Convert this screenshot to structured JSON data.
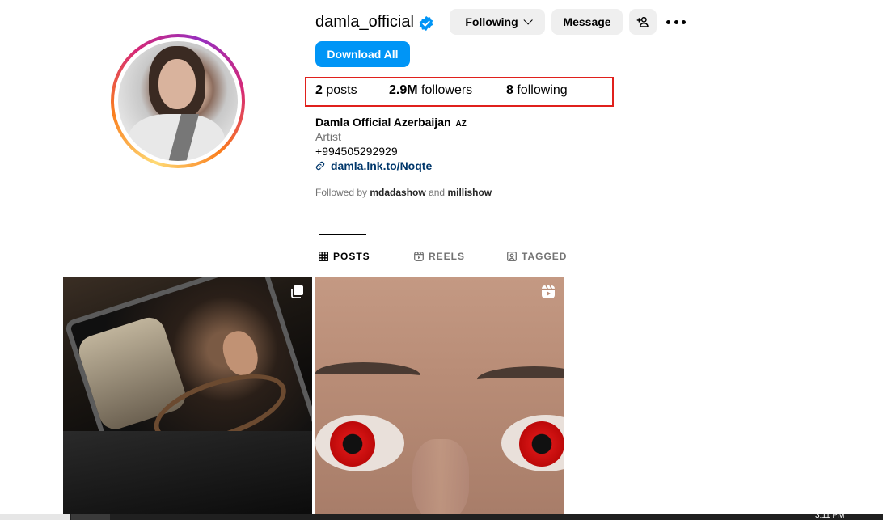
{
  "profile": {
    "username": "damla_official",
    "verified": true,
    "buttons": {
      "following": "Following",
      "message": "Message",
      "download_all": "Download All"
    },
    "stats": {
      "posts_count": "2",
      "posts_label": "posts",
      "followers_count": "2.9M",
      "followers_label": "followers",
      "following_count": "8",
      "following_label": "following"
    },
    "bio": {
      "name": "Damla Official Azerbaijan",
      "badge": "AZ",
      "category": "Artist",
      "phone": "+994505292929",
      "link": "damla.lnk.to/Noqte"
    },
    "followed_by": {
      "prefix": "Followed by",
      "user1": "mdadashow",
      "and": "and",
      "user2": "millishow"
    }
  },
  "tabs": [
    {
      "label": "POSTS",
      "icon": "grid-icon",
      "active": true
    },
    {
      "label": "REELS",
      "icon": "reels-icon",
      "active": false
    },
    {
      "label": "TAGGED",
      "icon": "tagged-icon",
      "active": false
    }
  ],
  "posts": [
    {
      "type": "carousel",
      "icon": "carousel-icon"
    },
    {
      "type": "reel",
      "icon": "reel-icon"
    }
  ],
  "taskbar": {
    "clock": "3:11 PM"
  },
  "colors": {
    "primary_button": "#0095f6",
    "highlight_box": "#e0201c",
    "link": "#00376b",
    "secondary_text": "#737373"
  }
}
